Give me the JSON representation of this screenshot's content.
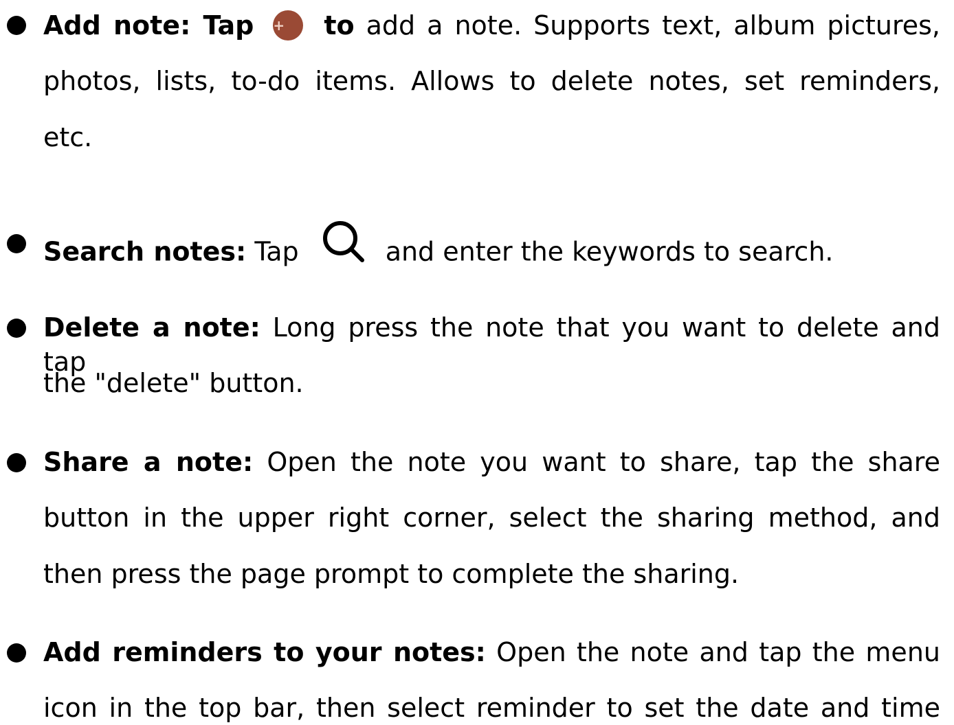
{
  "items": [
    {
      "title": "Add note: Tap",
      "icon": "add-note-icon",
      "title_after": "to",
      "text_line1": "add a note. Supports text, album pictures,",
      "text_line2": "photos, lists, to-do items. Allows to delete notes, set reminders,",
      "text_line3": "etc."
    },
    {
      "title": "Search notes:",
      "text_before": "Tap",
      "icon": "search-icon",
      "text_after": "and enter the keywords to search."
    },
    {
      "title": "Delete a note:",
      "text_line1": "Long press the note that you want to delete and tap",
      "text_line2": "the \"delete\" button."
    },
    {
      "title": "Share a note:",
      "text_line1": "Open the note you want to share, tap the share",
      "text_line2": "button in the upper right corner, select the sharing method, and",
      "text_line3": "then press the page prompt to complete the sharing."
    },
    {
      "title": "Add reminders to your notes:",
      "text_line1": "Open the note and tap the menu",
      "text_line2": "icon in the top bar, then select reminder to set the date and time"
    }
  ],
  "colors": {
    "add_icon": "#9a4a35",
    "text": "#000000"
  }
}
